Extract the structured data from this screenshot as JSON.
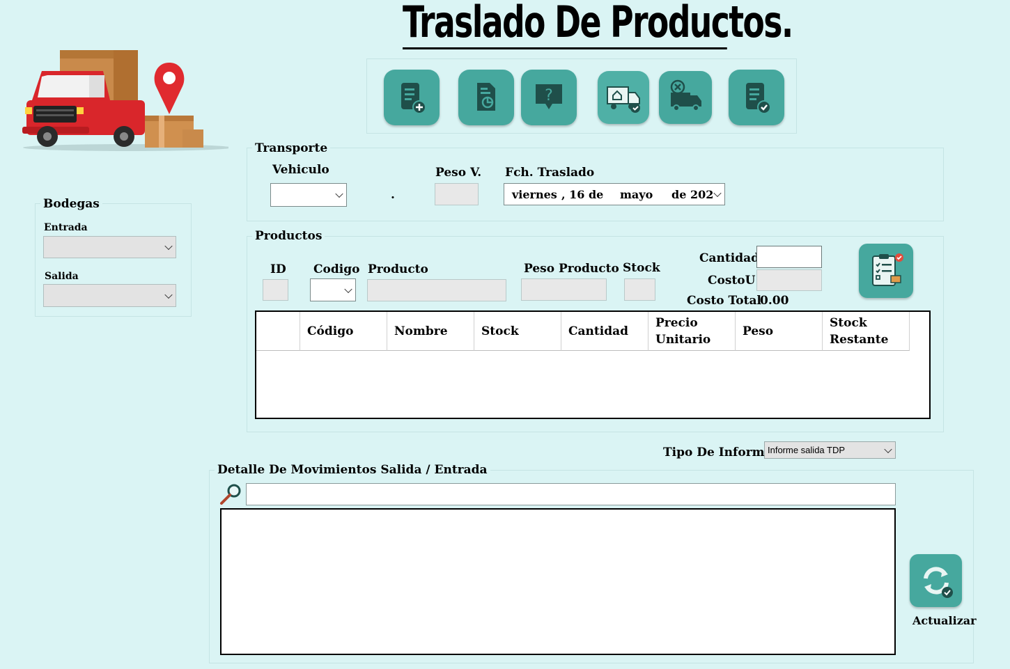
{
  "title": "Traslado De Productos.",
  "toolbar": {
    "buttons": [
      {
        "icon": "document-add-icon"
      },
      {
        "icon": "report-chart-icon"
      },
      {
        "icon": "help-question-icon"
      },
      {
        "icon": "truck-warehouse-check-icon"
      },
      {
        "icon": "truck-cancel-icon"
      },
      {
        "icon": "document-check-icon"
      }
    ]
  },
  "bodegas": {
    "legend": "Bodegas",
    "entrada_label": "Entrada",
    "entrada_value": "",
    "salida_label": "Salida",
    "salida_value": ""
  },
  "transporte": {
    "legend": "Transporte",
    "vehiculo_label": "Vehiculo",
    "vehiculo_value": "",
    "dot": ".",
    "peso_label": "Peso V.",
    "peso_value": "",
    "fecha_label": "Fch. Traslado",
    "fecha_day": "viernes",
    "fecha_sep1": ", 16 de",
    "fecha_month": "mayo",
    "fecha_year": "de 202"
  },
  "productos": {
    "legend": "Productos",
    "id_label": "ID",
    "codigo_label": "Codigo",
    "producto_label": "Producto",
    "peso_label": "Peso Producto",
    "stock_label": "Stock",
    "cantidad_label": "Cantidad",
    "costou_label": "CostoU",
    "costo_total_label": "Costo Total",
    "costo_total_value": "0.00",
    "columns": [
      "Código",
      "Nombre",
      "Stock",
      "Cantidad",
      "Precio\nUnitario",
      "Peso",
      "Stock\nRestante"
    ]
  },
  "informe": {
    "label": "Tipo De Informe.",
    "value": "Informe salida TDP"
  },
  "detalle": {
    "legend": "Detalle De Movimientos Salida / Entrada",
    "search_value": ""
  },
  "actualizar": {
    "label": "Actualizar"
  },
  "colors": {
    "background": "#daf4f4",
    "button_teal": "#46a89e",
    "truck_red": "#d9262b"
  }
}
